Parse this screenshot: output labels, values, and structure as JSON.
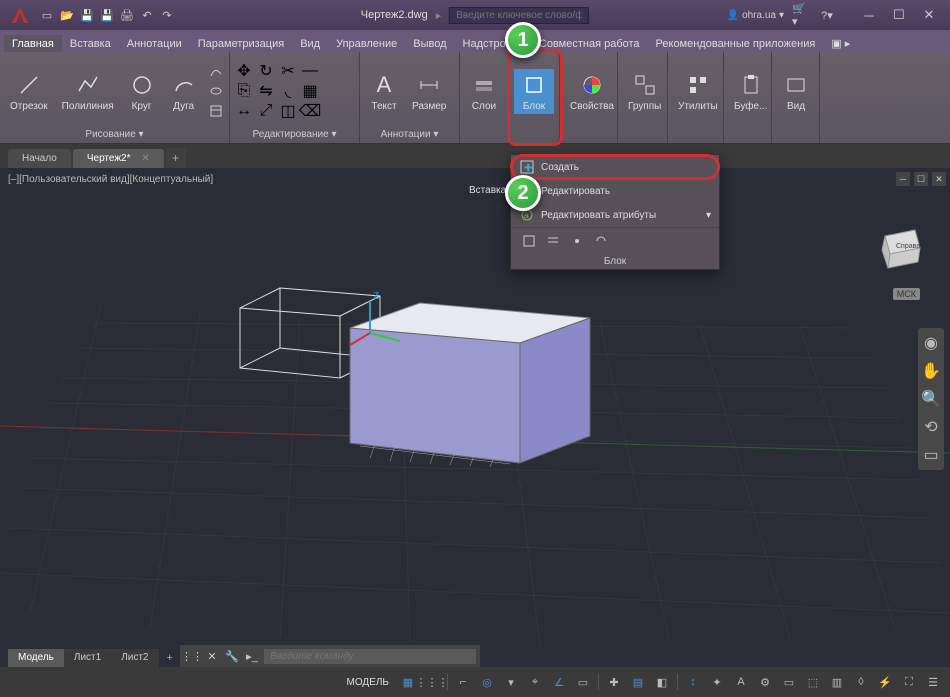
{
  "title": "Чертеж2.dwg",
  "search_placeholder": "Введите ключевое слово/фразу",
  "user": "ohra.ua",
  "menubar": [
    "Главная",
    "Вставка",
    "Аннотации",
    "Параметризация",
    "Вид",
    "Управление",
    "Вывод",
    "Надстройки",
    "Совместная работа",
    "Рекомендованные приложения"
  ],
  "active_menu": 0,
  "ribbon": {
    "draw": {
      "label": "Рисование ▾",
      "tools": [
        "Отрезок",
        "Полилиния",
        "Круг",
        "Дуга"
      ]
    },
    "edit": {
      "label": "Редактирование ▾"
    },
    "annot": {
      "label": "Аннотации ▾",
      "tools": [
        "Текст",
        "Размер"
      ]
    },
    "layers": {
      "label": "Слои"
    },
    "block": {
      "label": "Блок"
    },
    "props": {
      "label": "Свойства"
    },
    "groups": {
      "label": "Группы"
    },
    "utils": {
      "label": "Утилиты"
    },
    "clipboard": {
      "label": "Буфе..."
    },
    "view": {
      "label": "Вид"
    }
  },
  "draw_tabs": [
    "Начало",
    "Чертеж2*"
  ],
  "active_draw_tab": 1,
  "vp_label": "[–][Пользовательский вид][Концептуальный]",
  "viewcube": {
    "face": "Справа",
    "wcs": "МСК"
  },
  "block_menu": {
    "insert": "Вставка",
    "create": "Создать",
    "edit": "Редактировать",
    "edit_attrs": "Редактировать атрибуты",
    "panel": "Блок"
  },
  "cmd_placeholder": "Введите команду",
  "layout_tabs": [
    "Модель",
    "Лист1",
    "Лист2"
  ],
  "active_layout": 0,
  "status_model": "МОДЕЛЬ",
  "callouts": {
    "b1": "1",
    "b2": "2"
  }
}
